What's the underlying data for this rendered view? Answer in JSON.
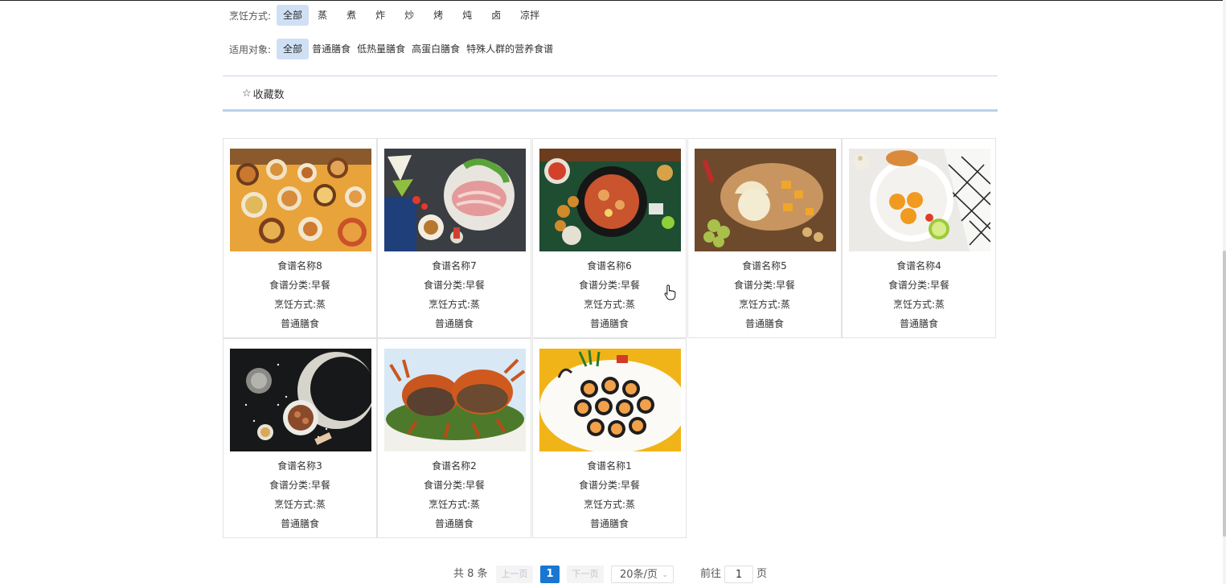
{
  "filters": {
    "cooking": {
      "label": "烹饪方式:",
      "options": [
        "全部",
        "蒸",
        "煮",
        "炸",
        "炒",
        "烤",
        "炖",
        "卤",
        "凉拌"
      ]
    },
    "target": {
      "label": "适用对象:",
      "options": [
        "全部",
        "普通膳食",
        "低热量膳食",
        "高蛋白膳食",
        "特殊人群的营养食谱"
      ]
    }
  },
  "sort": {
    "label": "收藏数",
    "icon": "star-outline-icon"
  },
  "recipes": [
    {
      "name": "食谱名称8",
      "category": "食谱分类:早餐",
      "cook": "烹饪方式:蒸",
      "target": "普通膳食",
      "theme": "orange-table"
    },
    {
      "name": "食谱名称7",
      "category": "食谱分类:早餐",
      "cook": "烹饪方式:蒸",
      "target": "普通膳食",
      "theme": "dark-hotpot"
    },
    {
      "name": "食谱名称6",
      "category": "食谱分类:早餐",
      "cook": "烹饪方式:蒸",
      "target": "普通膳食",
      "theme": "green-stew"
    },
    {
      "name": "食谱名称5",
      "category": "食谱分类:早餐",
      "cook": "烹饪方式:蒸",
      "target": "普通膳食",
      "theme": "cheese-board"
    },
    {
      "name": "食谱名称4",
      "category": "食谱分类:早餐",
      "cook": "烹饪方式:蒸",
      "target": "普通膳食",
      "theme": "white-dessert"
    },
    {
      "name": "食谱名称3",
      "category": "食谱分类:早餐",
      "cook": "烹饪方式:蒸",
      "target": "普通膳食",
      "theme": "dark-spices"
    },
    {
      "name": "食谱名称2",
      "category": "食谱分类:早餐",
      "cook": "烹饪方式:蒸",
      "target": "普通膳食",
      "theme": "crabs"
    },
    {
      "name": "食谱名称1",
      "category": "食谱分类:早餐",
      "cook": "烹饪方式:蒸",
      "target": "普通膳食",
      "theme": "sushi"
    }
  ],
  "pagination": {
    "total": "共 8 条",
    "prev": "上一页",
    "current": "1",
    "next": "下一页",
    "page_size": "20条/页",
    "goto_label": "前往",
    "goto_value": "1",
    "unit": "页"
  }
}
